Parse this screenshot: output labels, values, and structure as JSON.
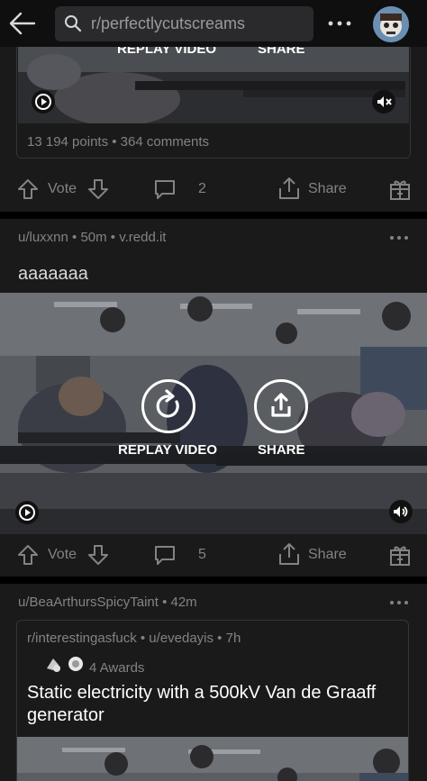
{
  "search": {
    "placeholder": "r/perfectlycutscreams"
  },
  "post1": {
    "replay_label": "REPLAY VIDEO",
    "share_label": "SHARE",
    "stats": "13 194 points • 364 comments",
    "vote_label": "Vote",
    "comment_count": "2",
    "share_action": "Share"
  },
  "post2": {
    "meta": "u/luxxnn • 50m • v.redd.it",
    "title": "aaaaaaa",
    "replay_label": "REPLAY VIDEO",
    "share_label": "SHARE",
    "vote_label": "Vote",
    "comment_count": "5",
    "share_action": "Share"
  },
  "post3": {
    "meta": "u/BeaArthursSpicyTaint • 42m",
    "crosspost_meta": "r/interestingasfuck • u/evedayis • 7h",
    "awards": "4 Awards",
    "title": "Static electricity with a 500kV Van de Graaff generator"
  },
  "icons": {
    "back": "arrow-left-icon",
    "search": "search-icon",
    "more": "ellipsis-icon",
    "upvote": "arrow-up-icon",
    "downvote": "arrow-down-icon",
    "comment": "speech-bubble-icon",
    "share": "share-icon",
    "award": "gift-icon",
    "replay": "replay-icon",
    "muted": "speaker-muted-icon",
    "sound": "speaker-on-icon"
  },
  "colors": {
    "background": "#1a1a1b",
    "text": "#d7dadc",
    "muted": "#818384"
  }
}
